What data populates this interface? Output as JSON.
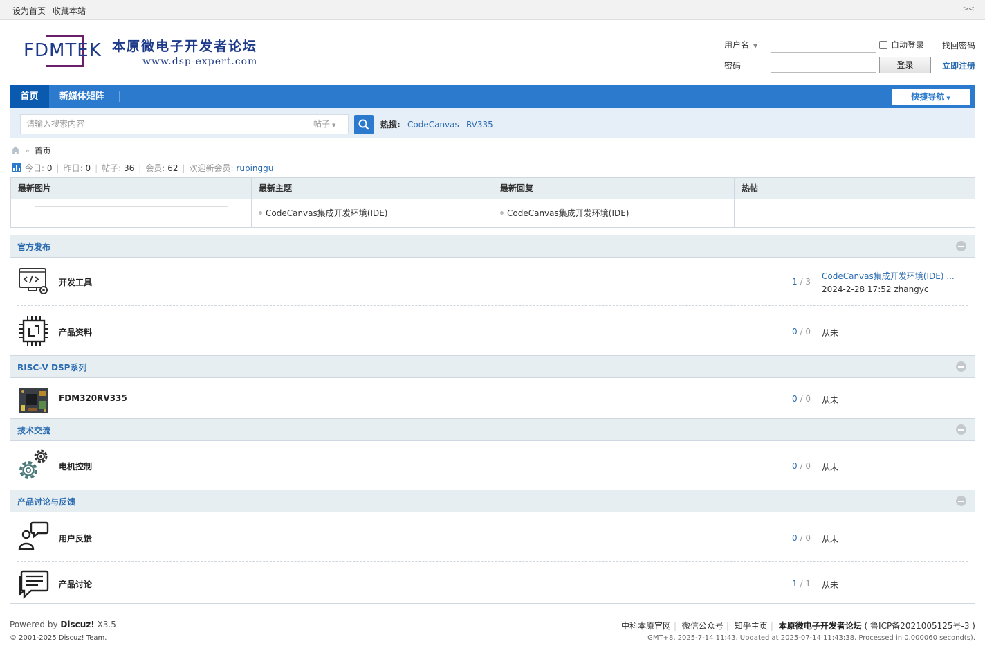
{
  "topbar": {
    "set_home": "设为首页",
    "bookmark": "收藏本站",
    "toggle": "><"
  },
  "logo": {
    "brand": "FDMTEK",
    "cn_name": "本原微电子开发者论坛",
    "url": "www.dsp-expert.com"
  },
  "login": {
    "username_label": "用户名",
    "password_label": "密码",
    "auto_login": "自动登录",
    "login_button": "登录",
    "forgot_password": "找回密码",
    "register": "立即注册"
  },
  "nav": {
    "home": "首页",
    "media": "新媒体矩阵",
    "quick_nav": "快捷导航"
  },
  "search": {
    "placeholder": "请输入搜索内容",
    "type": "帖子",
    "hot_label": "热搜:",
    "hot_terms": [
      "CodeCanvas",
      "RV335"
    ]
  },
  "breadcrumb": {
    "home": "首页"
  },
  "stats": {
    "today_label": "今日:",
    "today": "0",
    "yesterday_label": "昨日:",
    "yesterday": "0",
    "posts_label": "帖子:",
    "posts": "36",
    "members_label": "会员:",
    "members": "62",
    "welcome_label": "欢迎新会员:",
    "new_member": "rupinggu"
  },
  "grid": {
    "headers": [
      "最新图片",
      "最新主题",
      "最新回复",
      "热帖"
    ],
    "latest_topic": "CodeCanvas集成开发环境(IDE)",
    "latest_reply": "CodeCanvas集成开发环境(IDE)"
  },
  "groups": [
    {
      "title": "官方发布",
      "forums": [
        {
          "name": "开发工具",
          "threads": "1",
          "posts": "3",
          "last_title": "CodeCanvas集成开发环境(IDE) ...",
          "last_meta": "2024-2-28 17:52 zhangyc",
          "icon": "code-monitor-icon"
        },
        {
          "name": "产品资料",
          "threads": "0",
          "posts": "0",
          "last_title": "从未",
          "icon": "chip-icon"
        }
      ]
    },
    {
      "title": "RISC-V DSP系列",
      "forums": [
        {
          "name": "FDM320RV335",
          "threads": "0",
          "posts": "0",
          "last_title": "从未",
          "icon": "board-icon"
        }
      ]
    },
    {
      "title": "技术交流",
      "forums": [
        {
          "name": "电机控制",
          "threads": "0",
          "posts": "0",
          "last_title": "从未",
          "icon": "gears-icon"
        }
      ]
    },
    {
      "title": "产品讨论与反馈",
      "forums": [
        {
          "name": "用户反馈",
          "threads": "0",
          "posts": "0",
          "last_title": "从未",
          "icon": "feedback-icon"
        },
        {
          "name": "产品讨论",
          "threads": "1",
          "posts": "1",
          "last_title": "从未",
          "icon": "discussion-icon"
        }
      ]
    }
  ],
  "footer": {
    "powered_by": "Powered by",
    "discuz": "Discuz!",
    "version": "X3.5",
    "copyright": "© 2001-2025 Discuz! Team.",
    "links": [
      "中科本原官网",
      "微信公众号",
      "知乎主页"
    ],
    "site_name": "本原微电子开发者论坛",
    "icp": "( 鲁ICP备2021005125号-3 )",
    "gmt": "GMT+8, 2025-7-14 11:43, Updated at 2025-07-14 11:43:38, Processed in 0.000060 second(s)."
  },
  "colors": {
    "nav_blue": "#2b7acd",
    "nav_active": "#0a5bb0",
    "link_blue": "#2b6cb0",
    "header_bg": "#e6eef2"
  }
}
